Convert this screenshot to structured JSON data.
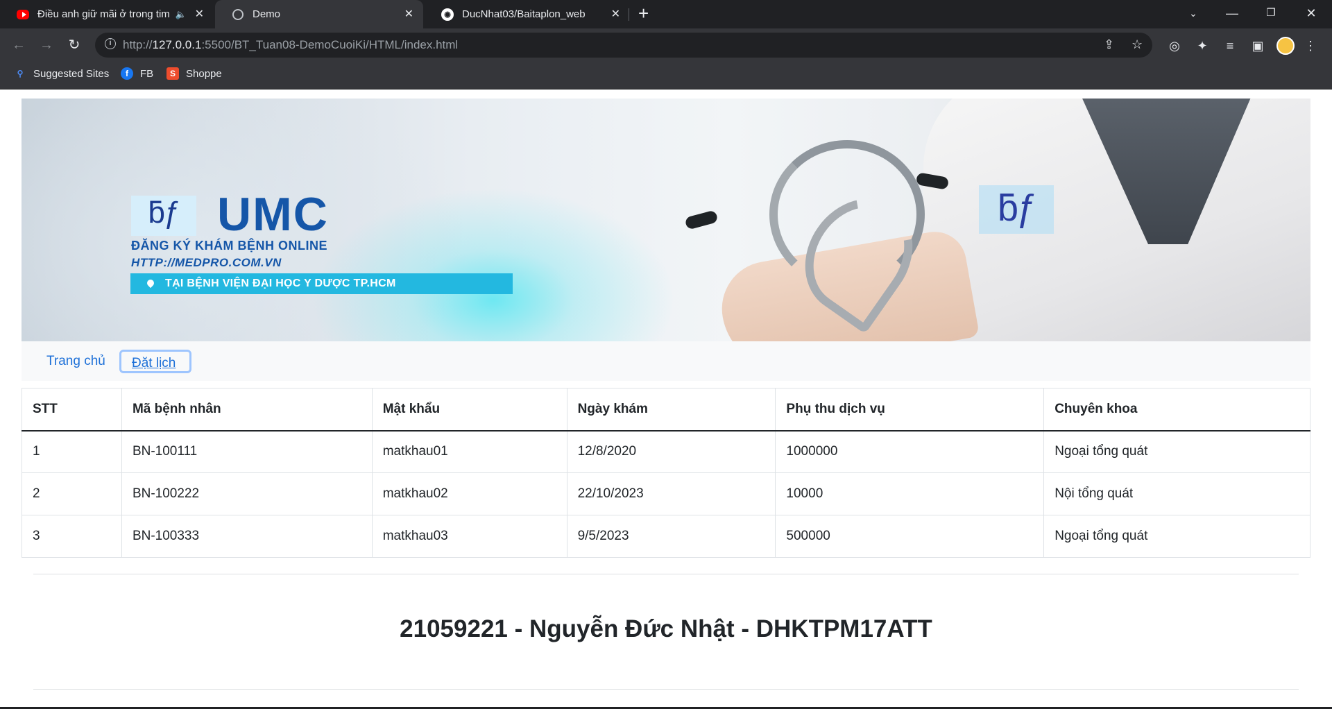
{
  "browser": {
    "tabs": [
      {
        "title": "Điều anh giữ mãi ở trong tim",
        "favicon": "youtube-icon",
        "audio": true
      },
      {
        "title": "Demo",
        "favicon": "globe-icon",
        "active": true
      },
      {
        "title": "DucNhat03/Baitaplon_web",
        "favicon": "github-icon"
      }
    ],
    "url_prefix": "http://",
    "url_host": "127.0.0.1",
    "url_rest": ":5500/BT_Tuan08-DemoCuoiKi/HTML/index.html",
    "bookmarks": [
      {
        "label": "Suggested Sites",
        "icon": "search-icon"
      },
      {
        "label": "FB",
        "icon": "facebook-icon",
        "color": "#1877f2"
      },
      {
        "label": "Shoppe",
        "icon": "shopee-icon",
        "color": "#ee4d2d"
      }
    ]
  },
  "banner": {
    "logo_text": "UMC",
    "tagline": "ĐĂNG KÝ KHÁM BỆNH ONLINE",
    "site": "HTTP://MEDPRO.COM.VN",
    "hospital": "TẠI BỆNH VIỆN ĐẠI HỌC Y DƯỢC TP.HCM"
  },
  "nav": {
    "home": "Trang chủ",
    "booking": "Đặt lịch"
  },
  "table": {
    "headers": [
      "STT",
      "Mã bệnh nhân",
      "Mật khẩu",
      "Ngày khám",
      "Phụ thu dịch vụ",
      "Chuyên khoa"
    ],
    "rows": [
      [
        "1",
        "BN-100111",
        "matkhau01",
        "12/8/2020",
        "1000000",
        "Ngoại tổng quát"
      ],
      [
        "2",
        "BN-100222",
        "matkhau02",
        "22/10/2023",
        "10000",
        "Nội tổng quát"
      ],
      [
        "3",
        "BN-100333",
        "matkhau03",
        "9/5/2023",
        "500000",
        "Ngoại tổng quát"
      ]
    ]
  },
  "footer": {
    "text": "21059221 - Nguyễn Đức Nhật - DHKTPM17ATT"
  },
  "colors": {
    "link": "#1d70d8",
    "brand_blue": "#1556a8",
    "hospital_bar": "#23b8e0"
  }
}
